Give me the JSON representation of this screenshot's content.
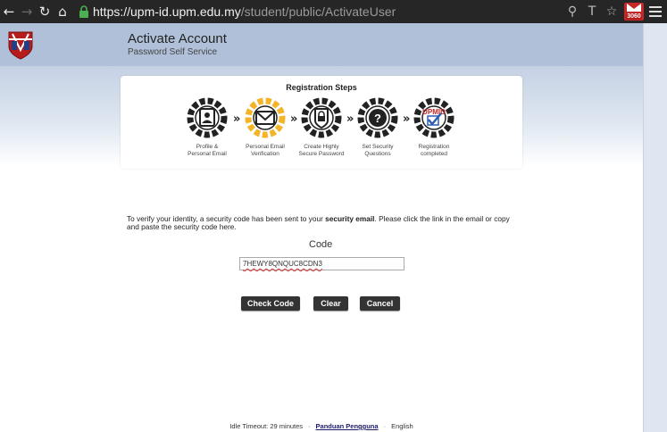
{
  "browser": {
    "url_host": "https://upm-id.upm.edu.my",
    "url_path": "/student/public/ActivateUser",
    "gmail_count": "3060"
  },
  "header": {
    "title": "Activate Account",
    "subtitle": "Password Self Service"
  },
  "steps": {
    "title": "Registration Steps",
    "items": [
      {
        "line1": "Profile &",
        "line2": "Personal Email"
      },
      {
        "line1": "Personal Email",
        "line2": "Verification"
      },
      {
        "line1": "Create Highly",
        "line2": "Secure Password"
      },
      {
        "line1": "Set Security",
        "line2": "Questions"
      },
      {
        "line1": "Registration",
        "line2": "completed"
      }
    ],
    "done_logo_text": "UPMID",
    "colors": {
      "active": "#f4b428",
      "inactive": "#222222",
      "check": "#2a5db0"
    }
  },
  "main": {
    "info_before": "To verify your identity, a security code has been sent to your ",
    "info_bold": "security email",
    "info_after": ". Please click the link in the email or copy and paste the security code here.",
    "code_label": "Code",
    "code_value": "7HEWY8QNQUC8CDN3"
  },
  "buttons": {
    "check": "Check Code",
    "clear": "Clear",
    "cancel": "Cancel"
  },
  "footer": {
    "idle": "Idle Timeout: 29 minutes",
    "guide": "Panduan Pengguna",
    "language": "English"
  }
}
